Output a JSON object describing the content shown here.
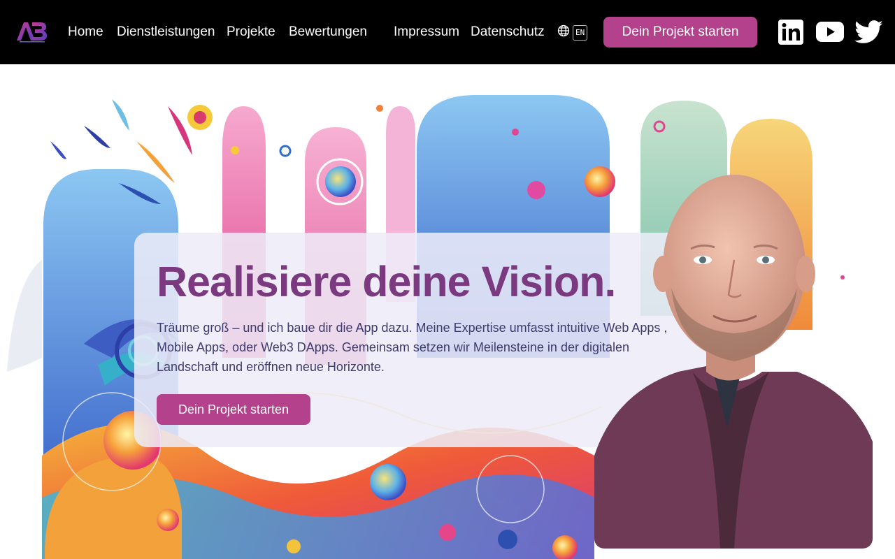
{
  "header": {
    "logo_icon": "ab-monogram-logo",
    "nav": [
      {
        "label": "Home"
      },
      {
        "label": "Dienstleistungen"
      },
      {
        "label": "Projekte"
      },
      {
        "label": "Bewertungen"
      },
      {
        "label": "Impressum"
      },
      {
        "label": "Datenschutz"
      }
    ],
    "language": {
      "icon": "globe-icon",
      "code": "EN"
    },
    "cta_label": "Dein Projekt starten",
    "social": [
      {
        "icon": "linkedin-icon"
      },
      {
        "icon": "youtube-icon"
      },
      {
        "icon": "twitter-icon"
      }
    ]
  },
  "hero": {
    "headline": "Realisiere deine Vision.",
    "lead": "Träume groß – und ich baue dir die App dazu. Meine Expertise umfasst intuitive Web Apps , Mobile Apps, oder Web3 DApps. Gemeinsam setzen wir Meilensteine in der digitalen Landschaft und eröffnen neue Horizonte.",
    "cta_label": "Dein Projekt starten"
  },
  "colors": {
    "header_bg": "#000000",
    "accent": "#b4418b",
    "headline": "#7b3a80",
    "body_text": "#3e3a6d"
  }
}
